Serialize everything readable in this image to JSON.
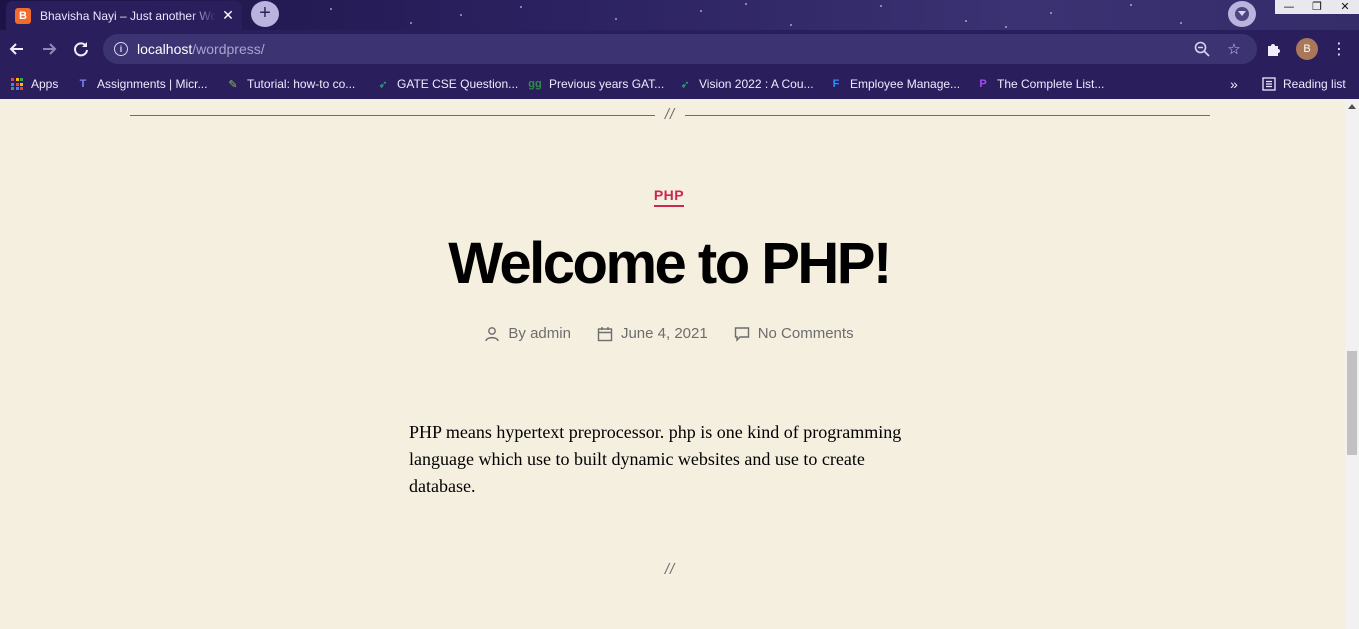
{
  "browser": {
    "tab_title": "Bhavisha Nayi – Just another WordPress site",
    "tab_favicon_glyph": "B",
    "url_host": "localhost",
    "url_path": "/wordpress/",
    "profile_initial": "B",
    "accent_color": "#2a1f5c"
  },
  "bookmarks": {
    "items": [
      {
        "label": "Apps",
        "icon": "apps-grid-icon"
      },
      {
        "label": "Assignments | Micr...",
        "icon": "teams-icon"
      },
      {
        "label": "Tutorial: how-to co...",
        "icon": "tutorial-icon"
      },
      {
        "label": "GATE CSE Question...",
        "icon": "rocket-icon"
      },
      {
        "label": "Previous years GAT...",
        "icon": "gfg-icon"
      },
      {
        "label": "Vision 2022 : A Cou...",
        "icon": "rocket-icon"
      },
      {
        "label": "Employee Manage...",
        "icon": "f-logo-icon"
      },
      {
        "label": "The Complete List...",
        "icon": "p-logo-icon"
      }
    ],
    "overflow_label": "»",
    "reading_list_label": "Reading list"
  },
  "post": {
    "separator_mark": "//",
    "category": "PHP",
    "category_color": "#cd2653",
    "title": "Welcome to PHP!",
    "author_text": "By admin",
    "date": "June 4, 2021",
    "comments": "No Comments",
    "body": "PHP means hypertext preprocessor. php is one kind of programming language which use to built dynamic websites and use to create database.",
    "bottom_mark": "//"
  }
}
